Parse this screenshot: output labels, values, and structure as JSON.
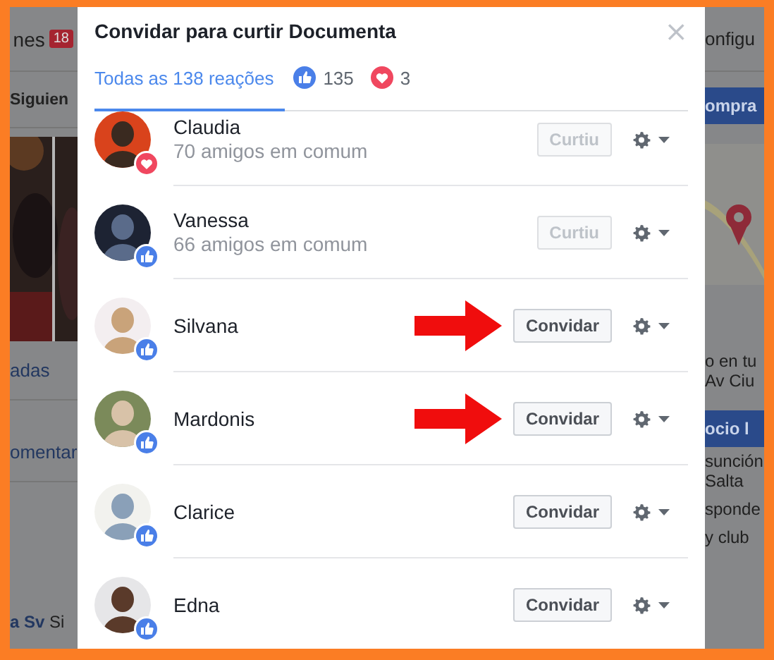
{
  "background": {
    "left": [
      {
        "kind": "text",
        "text": "nes",
        "badge": "18"
      },
      {
        "kind": "tab",
        "text": "Siguien"
      },
      {
        "kind": "picture"
      },
      {
        "kind": "link",
        "text": "adas"
      },
      {
        "kind": "link",
        "text": "omentar"
      },
      {
        "kind": "footer",
        "bold": "a Sv",
        "text": "Si"
      }
    ],
    "right": [
      {
        "kind": "text",
        "text": "onfigu"
      },
      {
        "kind": "button",
        "text": "ompra"
      },
      {
        "kind": "picture"
      },
      {
        "kind": "lines",
        "lines": [
          "o en tu",
          "Av Ciu"
        ]
      },
      {
        "kind": "button",
        "text": "ocio l"
      },
      {
        "kind": "lines",
        "lines": [
          "sunción",
          "Salta"
        ]
      },
      {
        "kind": "lines",
        "lines": [
          "sponde"
        ]
      },
      {
        "kind": "lines",
        "lines": [
          "y club"
        ]
      }
    ]
  },
  "dialog": {
    "title": "Convidar para curtir Documenta",
    "close": "×",
    "tabs": [
      {
        "kind": "all",
        "label": "Todas as 138 reações",
        "selected": true
      },
      {
        "kind": "like",
        "label": "135",
        "selected": false
      },
      {
        "kind": "love",
        "label": "3",
        "selected": false
      }
    ],
    "people": [
      {
        "name": "Claudia",
        "mutual": "70 amigos em comum",
        "kind": "love",
        "action": "Curtiu",
        "disabled": true,
        "arrow": false
      },
      {
        "name": "Vanessa",
        "mutual": "66 amigos em comum",
        "kind": "like",
        "action": "Curtiu",
        "disabled": true,
        "arrow": false
      },
      {
        "name": "Silvana",
        "kind": "like",
        "action": "Convidar",
        "disabled": false,
        "arrow": true
      },
      {
        "name": "Mardonis",
        "kind": "like",
        "action": "Convidar",
        "disabled": false,
        "arrow": true
      },
      {
        "name": "Clarice",
        "kind": "like",
        "action": "Convidar",
        "disabled": false,
        "arrow": false
      },
      {
        "name": "Edna",
        "kind": "like",
        "action": "Convidar",
        "disabled": false,
        "arrow": false
      }
    ]
  }
}
